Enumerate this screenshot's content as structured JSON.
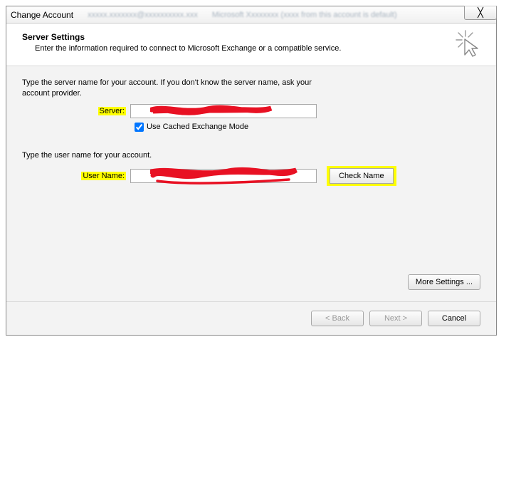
{
  "window": {
    "title": "Change Account",
    "close_glyph": "╳"
  },
  "header": {
    "heading": "Server Settings",
    "subheading": "Enter the information required to connect to Microsoft Exchange or a compatible service."
  },
  "content": {
    "server_instruction": "Type the server name for your account. If you don't know the server name, ask your account provider.",
    "server_label": "Server:",
    "server_value": "",
    "cached_mode_label": "Use Cached Exchange Mode",
    "cached_mode_checked": true,
    "user_instruction": "Type the user name for your account.",
    "user_label": "User Name:",
    "user_value": "",
    "check_name_label": "Check Name",
    "more_settings_label": "More Settings ..."
  },
  "footer": {
    "back_label": "< Back",
    "next_label": "Next >",
    "cancel_label": "Cancel"
  }
}
